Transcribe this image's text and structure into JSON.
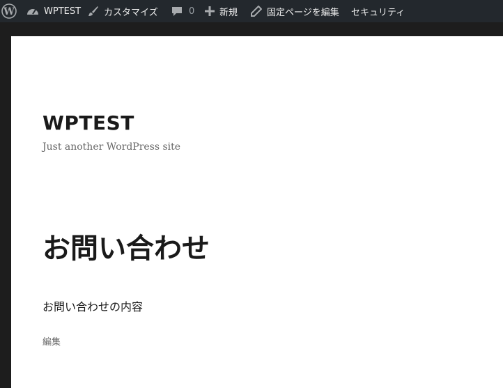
{
  "adminbar": {
    "logo_icon": "wordpress-logo-icon",
    "site_name": "WPTEST",
    "customize_label": "カスタマイズ",
    "comments_count": "0",
    "new_label": "新規",
    "edit_page_label": "固定ページを編集",
    "security_label": "セキュリティ"
  },
  "site": {
    "title": "WPTEST",
    "description": "Just another WordPress site"
  },
  "entry": {
    "title": "お問い合わせ",
    "content": "お問い合わせの内容",
    "edit_link": "編集"
  },
  "colors": {
    "adminbar_bg": "#23282d",
    "adminbar_text": "#eeeeee",
    "page_bg": "#ffffff",
    "frame_bg": "#1d1d1d",
    "text": "#1a1a1a",
    "muted_text": "#686868"
  }
}
